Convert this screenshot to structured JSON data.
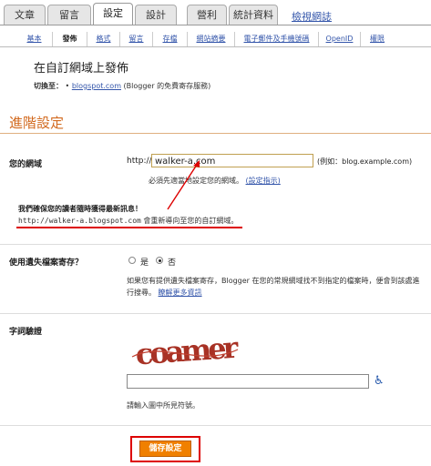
{
  "tabs": [
    {
      "label": "文章"
    },
    {
      "label": "留言"
    },
    {
      "label": "設定"
    },
    {
      "label": "設計"
    },
    {
      "label": "營利"
    },
    {
      "label": "統計資料"
    }
  ],
  "view_blog_link": "檢視網誌",
  "subtabs": [
    {
      "label": "基本"
    },
    {
      "label": "發佈"
    },
    {
      "label": "格式"
    },
    {
      "label": "留言"
    },
    {
      "label": "存檔"
    },
    {
      "label": "網站摘要"
    },
    {
      "label": "電子郵件及手機號碼"
    },
    {
      "label": "OpenID"
    },
    {
      "label": "權限"
    }
  ],
  "page_title": "在自訂網域上發佈",
  "switch": {
    "prefix": "切換至：",
    "bullet": "•",
    "link": "blogspot.com",
    "suffix": "(Blogger 的免費寄存服務)"
  },
  "section_title": "進階設定",
  "domain": {
    "label": "您的網域",
    "prefix": "http://",
    "value": "walker-a.com",
    "example": "(例如：blog.example.com)",
    "note": "必須先適當地設定您的網域。",
    "note_link": "(設定指示)"
  },
  "ensure_msg": "我們確保您的讀者隨時獲得最新訊息！",
  "redirect": {
    "url": "http://walker-a.blogspot.com",
    "text": "會重新導向至您的自訂網域。"
  },
  "missing_files": {
    "label": "使用遺失檔案寄存？",
    "yes": "是",
    "no": "否",
    "note": "如果您有提供遺失檔案寄存，Blogger 在您的常規網域找不到指定的檔案時，便會到該處進行搜尋。",
    "note_link": "瞭解更多資訊"
  },
  "captcha": {
    "label": "字詞驗證",
    "word": "coamer",
    "input_value": "",
    "note": "請輸入圖中所見符號。"
  },
  "save_button": "儲存設定",
  "colors": {
    "accent_orange": "#f08000",
    "highlight_red": "#dd0000",
    "link_blue": "#3355aa",
    "section_orange": "#d2691e"
  },
  "icons": {
    "accessibility": "wheelchair-icon"
  }
}
